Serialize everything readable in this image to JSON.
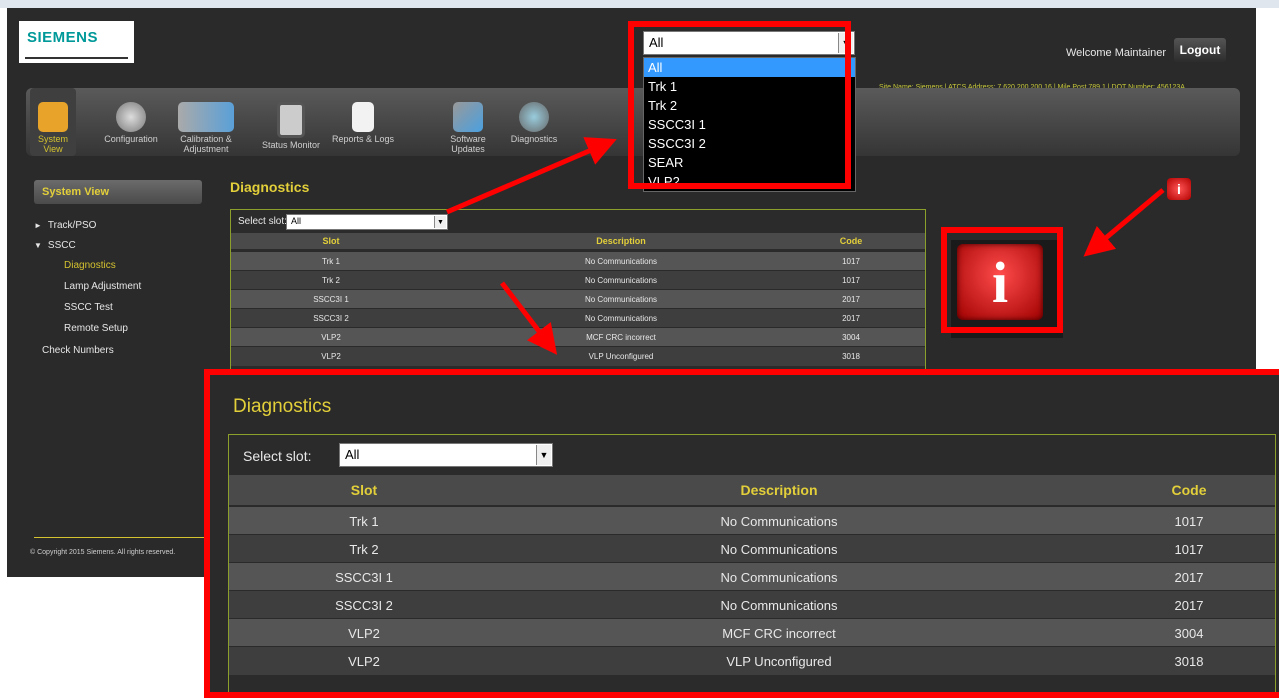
{
  "app": {
    "brand": "SIEMENS",
    "welcome": "Welcome Maintainer",
    "logout": "Logout",
    "site_info": "Site Name: Siemens | ATCS Address: 7.620.200.200.16 | Mile Post 789.1 | DOT Number: 456123A",
    "copyright": "© Copyright 2015 Siemens. All rights reserved."
  },
  "toolbar": {
    "items": [
      {
        "label": "System View",
        "icon": "house-icon"
      },
      {
        "label": "Configuration",
        "icon": "gear-icon"
      },
      {
        "label": "Calibration & Adjustment",
        "icon": "calibration-icon"
      },
      {
        "label": "Status Monitor",
        "icon": "monitor-icon"
      },
      {
        "label": "Reports & Logs",
        "icon": "report-icon"
      },
      {
        "label": "Software Updates",
        "icon": "software-update-icon"
      },
      {
        "label": "Diagnostics",
        "icon": "magnifier-icon"
      }
    ]
  },
  "sidebar": {
    "header": "System View",
    "items": [
      "Track/PSO",
      "SSCC",
      "Diagnostics",
      "Lamp Adjustment",
      "SSCC Test",
      "Remote Setup",
      "Check Numbers"
    ]
  },
  "diagnostics": {
    "title": "Diagnostics",
    "select_label": "Select slot:",
    "select_value": "All",
    "columns": [
      "Slot",
      "Description",
      "Code"
    ],
    "rows": [
      [
        "Trk 1",
        "No Communications",
        "1017"
      ],
      [
        "Trk 2",
        "No Communications",
        "1017"
      ],
      [
        "SSCC3I 1",
        "No Communications",
        "2017"
      ],
      [
        "SSCC3I 2",
        "No Communications",
        "2017"
      ],
      [
        "VLP2",
        "MCF CRC incorrect",
        "3004"
      ],
      [
        "VLP2",
        "VLP Unconfigured",
        "3018"
      ]
    ]
  },
  "dropdown": {
    "value": "All",
    "options": [
      "All",
      "Trk 1",
      "Trk 2",
      "SSCC3I 1",
      "SSCC3I 2",
      "SEAR",
      "VLP2"
    ]
  },
  "info_icon": "i",
  "colors": {
    "accent_yellow": "#e2cf3a",
    "panel_border": "#8aa02a",
    "highlight_red": "#ff0000",
    "background": "#2a2a2a"
  }
}
